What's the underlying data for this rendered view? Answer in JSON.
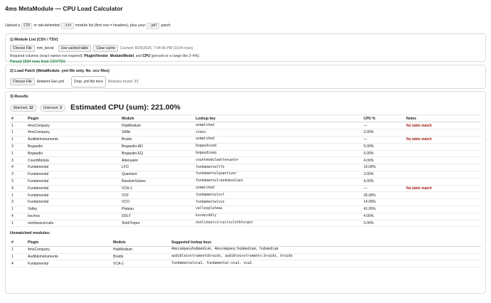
{
  "page": {
    "title": "4ms MetaModule — CPU Load Calculator",
    "intro": {
      "pre": "Upload a",
      "csv": "CSV",
      "mid1": "or tab-delimited",
      "txt": ".txt",
      "mid2": "module list (first row = headers), plus your",
      "yml": ".yml",
      "post": "patch."
    }
  },
  "module_list": {
    "title": "1) Module List (CSV / TSV)",
    "choose_file_label": "Choose File",
    "file_name": "mm_list.txt",
    "use_cached_label": "Use cached table",
    "clear_cache_label": "Clear cache",
    "cached_info": "Cached: 8/25/2025, 7:04:45 PM (1534 rows)",
    "required_pre": "Required columns (exact names not required):",
    "required_cols": "Plugin/Vendor",
    "required_sep1": ",",
    "required_cols2": "Module/Model",
    "required_sep2": ", and",
    "required_cols3": "CPU",
    "required_post": "(percent or a range like 2–4%).",
    "parsed_status": "Parsed 1534 rows from CSV/TSV."
  },
  "load_patch": {
    "title": "2) Load Patch (MetaModule .yml file only. No .vcv files)",
    "choose_file_label": "Choose File",
    "file_name": "Ambient Gen.yml",
    "drop_label": "Drop .yml file here",
    "modules_found": "Modules found: 33"
  },
  "results": {
    "title": "3) Results",
    "matched_label": "Matched:",
    "matched_value": "12",
    "unknown_label": "Unknown:",
    "unknown_value": "3",
    "estimate": "Estimated CPU (sum): 221.00%",
    "columns": [
      "#",
      "Plugin",
      "Module",
      "Lookup key",
      "CPU %",
      "Notes"
    ],
    "rows": [
      {
        "n": "1",
        "plugin": "4msCompany",
        "module": "HubMedium",
        "key": "unmatched",
        "cpu": "—",
        "note": "No table match"
      },
      {
        "n": "1",
        "plugin": "4msCompany",
        "module": "StMix",
        "key": "stmix",
        "cpu": "2.00%",
        "note": ""
      },
      {
        "n": "1",
        "plugin": "AudibleInstruments",
        "module": "Braids",
        "key": "unmatched",
        "cpu": "—",
        "note": "No table match"
      },
      {
        "n": "3",
        "plugin": "Bogaudio",
        "module": "Bogaudio-AD",
        "key": "bogaudioad",
        "cpu": "5.00%",
        "note": ""
      },
      {
        "n": "1",
        "plugin": "Bogaudio",
        "module": "Bogaudio-EQ",
        "key": "bogaudioeq",
        "cpu": "5.00%",
        "note": ""
      },
      {
        "n": "3",
        "plugin": "CountModula",
        "module": "Attenuator",
        "key": "countmodulaattenuator",
        "cpu": "4.00%",
        "note": ""
      },
      {
        "n": "4",
        "plugin": "Fundamental",
        "module": "LFO",
        "key": "fundamentallfo",
        "cpu": "10.00%",
        "note": ""
      },
      {
        "n": "3",
        "plugin": "Fundamental",
        "module": "Quantizer",
        "key": "fundamentalquantizer",
        "cpu": "3.00%",
        "note": ""
      },
      {
        "n": "3",
        "plugin": "Fundamental",
        "module": "RandomValues",
        "key": "fundamentalrandomvalues",
        "cpu": "4.00%",
        "note": ""
      },
      {
        "n": "4",
        "plugin": "Fundamental",
        "module": "VCA-1",
        "key": "unmatched",
        "cpu": "—",
        "note": "No table match"
      },
      {
        "n": "1",
        "plugin": "Fundamental",
        "module": "VCF",
        "key": "fundamentalvcf",
        "cpu": "26.00%",
        "note": ""
      },
      {
        "n": "3",
        "plugin": "Fundamental",
        "module": "VCO",
        "key": "fundamentalvco",
        "cpu": "14.00%",
        "note": ""
      },
      {
        "n": "1",
        "plugin": "Valley",
        "module": "Plateau",
        "key": "valleyplateau",
        "cpu": "41.00%",
        "note": ""
      },
      {
        "n": "4",
        "plugin": "kocmoc",
        "module": "DDLY",
        "key": "kocmocddly",
        "cpu": "4.00%",
        "note": ""
      },
      {
        "n": "1",
        "plugin": "nonlinearcircuits",
        "module": "SlothTorpor",
        "key": "nonlinearcircuitsslothtorpor",
        "cpu": "5.00%",
        "note": ""
      }
    ],
    "unmatched_title": "Unmatched modules:",
    "unmatched_columns": [
      "#",
      "Plugin",
      "Module",
      "Suggested lookup keys"
    ],
    "unmatched_rows": [
      {
        "n": "1",
        "plugin": "4msCompany",
        "module": "HubMedium",
        "keys": "4mscompanyhubmedium, 4mscompany:hubmedium, hubmedium"
      },
      {
        "n": "1",
        "plugin": "AudibleInstruments",
        "module": "Braids",
        "keys": "audibleinstrumentsbraids, audibleinstruments:braids, braids"
      },
      {
        "n": "4",
        "plugin": "Fundamental",
        "module": "VCA-1",
        "keys": "fundamentalvca1, fundamental:vca1, vca1"
      }
    ]
  },
  "colors": {
    "parsed_green": "#1a7f37",
    "note_red": "#a11a1a"
  }
}
